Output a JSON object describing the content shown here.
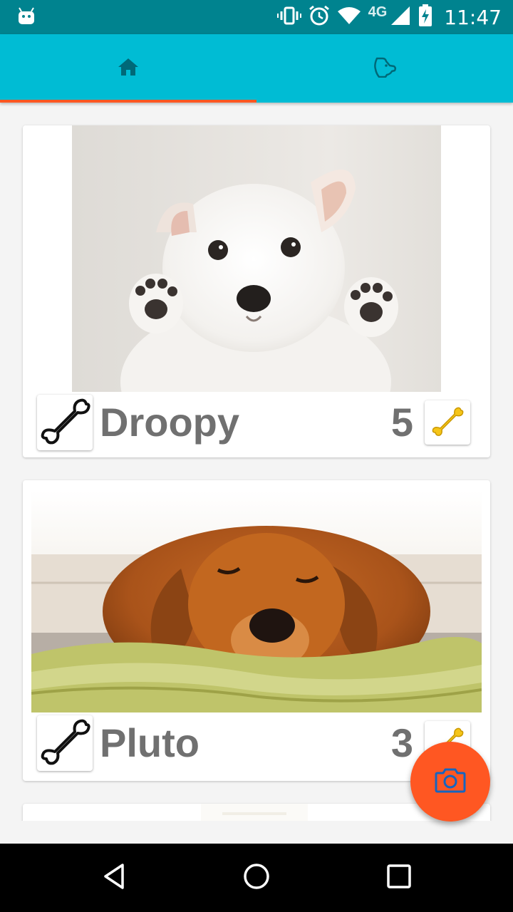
{
  "status_bar": {
    "time": "11:47",
    "network": "4G",
    "icons": [
      "android-icon",
      "vibrate-icon",
      "alarm-icon",
      "wifi-icon",
      "signal-icon",
      "battery-charging-icon"
    ]
  },
  "tabs": [
    {
      "icon": "home-icon",
      "selected": true
    },
    {
      "icon": "dog-head-icon",
      "selected": false
    }
  ],
  "dogs": [
    {
      "name": "Droopy",
      "bones": "5",
      "photo": "white-puppy-photo"
    },
    {
      "name": "Pluto",
      "bones": "3",
      "photo": "golden-puppy-photo"
    }
  ],
  "fab": {
    "icon": "camera-icon"
  },
  "colors": {
    "status_bar": "#00838f",
    "toolbar": "#00bcd4",
    "accent": "#ff5722",
    "text": "#707070",
    "bone_gold": "#f5c518"
  },
  "nav": {
    "icons": [
      "back-icon",
      "home-circle-icon",
      "recents-icon"
    ]
  }
}
